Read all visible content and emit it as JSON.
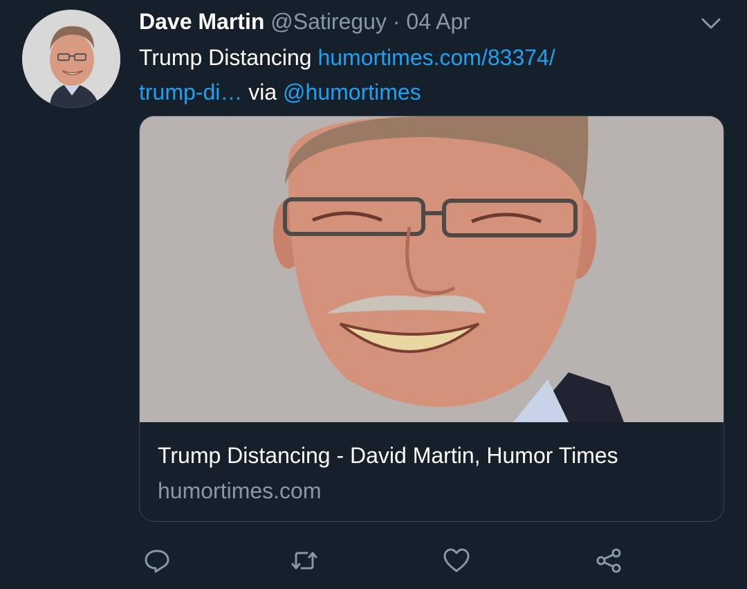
{
  "tweet": {
    "author_name": "Dave Martin",
    "author_handle": "@Satireguy",
    "separator": "·",
    "date": "04 Apr",
    "text_prefix": "Trump Distancing ",
    "link_line1": "humortimes.com/83374/",
    "link_line2": "trump-di…",
    "text_via": " via ",
    "mention": "@humortimes"
  },
  "card": {
    "title": "Trump Distancing - David Martin, Humor Times",
    "domain": "humortimes.com"
  },
  "icons": {
    "menu": "chevron-down-icon",
    "reply": "comment-icon",
    "retweet": "retweet-icon",
    "like": "heart-icon",
    "share": "share-icon"
  },
  "colors": {
    "background": "#15202b",
    "text": "#ffffff",
    "muted": "#8899a6",
    "link": "#1da1f2",
    "border": "#38444d"
  }
}
